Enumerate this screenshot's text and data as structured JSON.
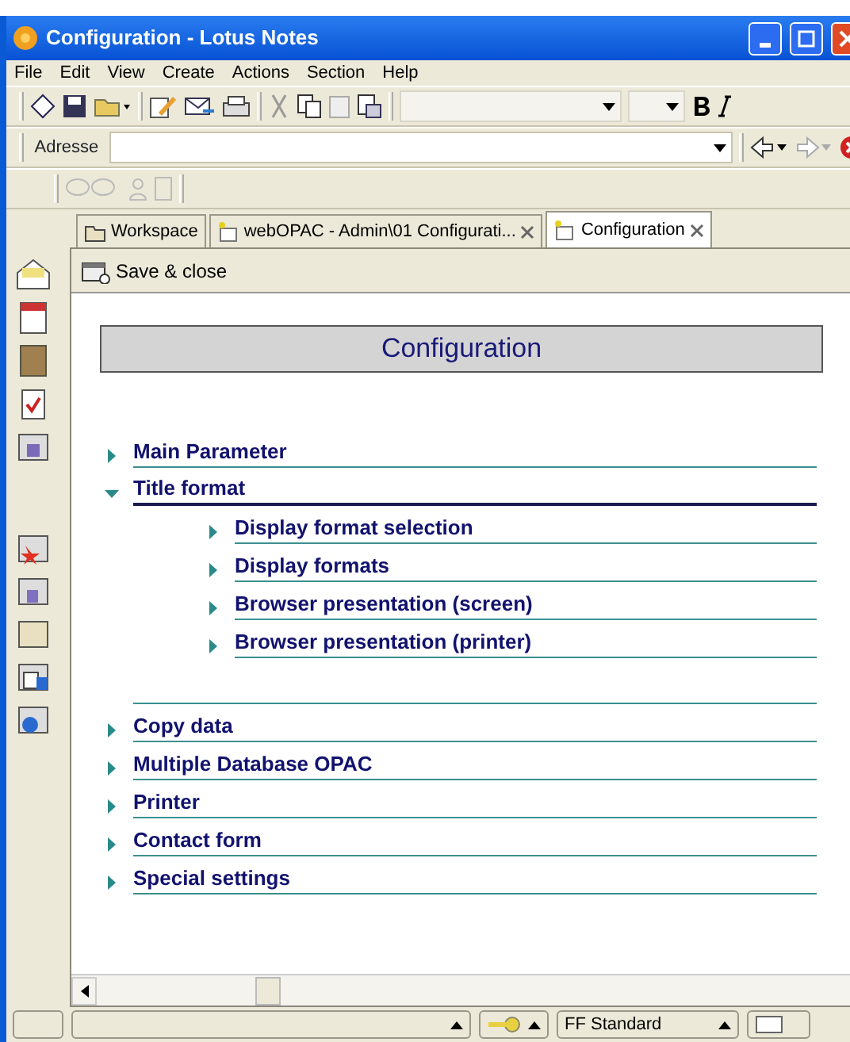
{
  "window": {
    "title": "Configuration - Lotus Notes"
  },
  "menu": [
    "File",
    "Edit",
    "View",
    "Create",
    "Actions",
    "Section",
    "Help"
  ],
  "address_bar": {
    "label": "Adresse"
  },
  "tabs": [
    {
      "label": "Workspace",
      "selected": false,
      "closable": false
    },
    {
      "label": "webOPAC - Admin\\01 Configurati...",
      "selected": false,
      "closable": true
    },
    {
      "label": "Configuration",
      "selected": true,
      "closable": true
    }
  ],
  "action_bar": {
    "button": "Save & close"
  },
  "document": {
    "heading": "Configuration",
    "sections": [
      {
        "label": "Main Parameter",
        "expanded": false
      },
      {
        "label": "Title format",
        "expanded": true,
        "children": [
          {
            "label": "Display format selection",
            "expanded": false
          },
          {
            "label": "Display formats",
            "expanded": false
          },
          {
            "label": "Browser presentation (screen)",
            "expanded": false
          },
          {
            "label": "Browser presentation (printer)",
            "expanded": false
          }
        ]
      },
      {
        "label": "Copy data",
        "expanded": false
      },
      {
        "label": "Multiple Database OPAC",
        "expanded": false
      },
      {
        "label": "Printer",
        "expanded": false
      },
      {
        "label": "Contact form",
        "expanded": false
      },
      {
        "label": "Special settings",
        "expanded": false
      }
    ]
  },
  "status_bar": {
    "style": "FF Standard"
  }
}
